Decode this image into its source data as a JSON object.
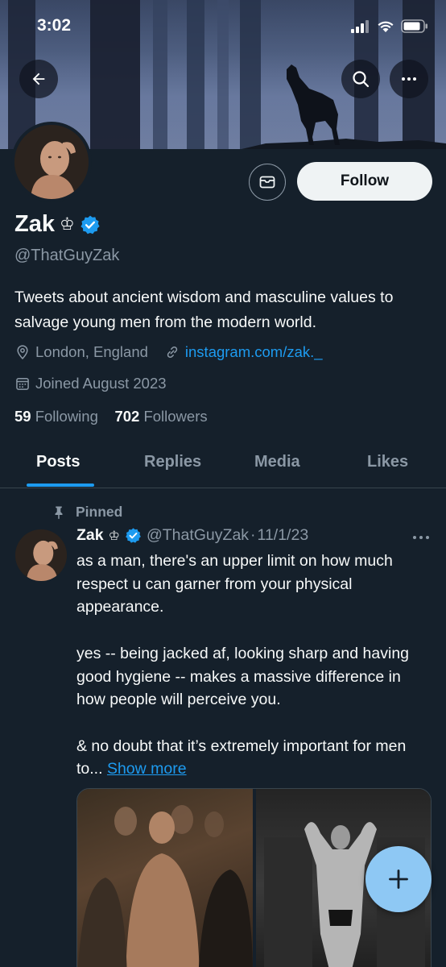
{
  "status_bar": {
    "time": "3:02"
  },
  "header": {
    "back_icon": "arrow-left-icon",
    "search_icon": "search-icon",
    "more_icon": "ellipsis-icon"
  },
  "profile": {
    "name": "Zak",
    "crown": "♔",
    "handle": "@ThatGuyZak",
    "bio": "Tweets about ancient wisdom and masculine values to salvage young men from the modern world.",
    "location": "London, England",
    "link": "instagram.com/zak._",
    "joined": "Joined August 2023",
    "following_count": "59",
    "following_label": "Following",
    "followers_count": "702",
    "followers_label": "Followers",
    "follow_label": "Follow",
    "verified_color": "#1d9bf0"
  },
  "tabs": [
    {
      "label": "Posts",
      "active": true
    },
    {
      "label": "Replies"
    },
    {
      "label": "Media"
    },
    {
      "label": "Likes"
    }
  ],
  "post": {
    "pinned_label": "Pinned",
    "author": "Zak",
    "crown": "♔",
    "handle": "@ThatGuyZak",
    "separator": "·",
    "date": "11/1/23",
    "para1": "as a man, there's an upper limit on how much respect u can garner from your physical appearance.",
    "para2": "yes -- being jacked af, looking sharp and having good hygiene -- makes a massive difference in how people will perceive you.",
    "para3": "& no doubt that it’s extremely important for men to...",
    "show_more": "Show more"
  },
  "colors": {
    "background": "#15202b",
    "accent": "#1d9bf0",
    "fab": "#8ec8f4"
  }
}
